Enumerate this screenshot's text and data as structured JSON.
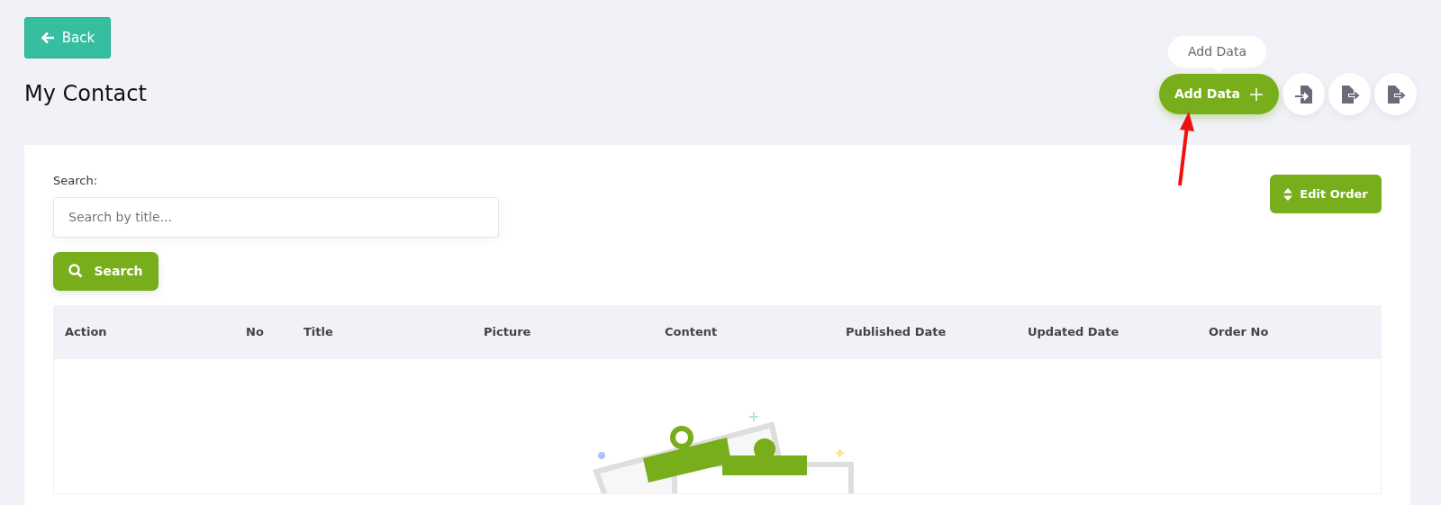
{
  "back_button": {
    "label": "Back"
  },
  "page_title": "My Contact",
  "add_button": {
    "label": "Add Data",
    "tooltip": "Add Data"
  },
  "toolbar_icons": [
    {
      "kind": "import"
    },
    {
      "kind": "export"
    },
    {
      "kind": "export"
    }
  ],
  "search": {
    "label": "Search:",
    "placeholder": "Search by title...",
    "button": "Search"
  },
  "edit_order_button": "Edit Order",
  "table": {
    "columns": [
      "Action",
      "No",
      "Title",
      "Picture",
      "Content",
      "Published Date",
      "Updated Date",
      "Order No"
    ]
  }
}
